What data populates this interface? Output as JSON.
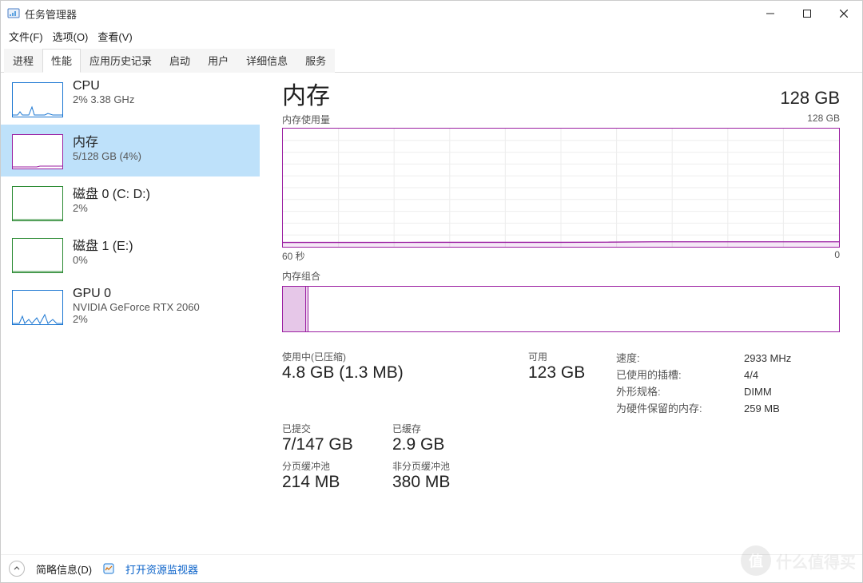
{
  "window": {
    "title": "任务管理器"
  },
  "menu": {
    "file": "文件(F)",
    "options": "选项(O)",
    "view": "查看(V)"
  },
  "tabs": {
    "processes": "进程",
    "performance": "性能",
    "app_history": "应用历史记录",
    "startup": "启动",
    "users": "用户",
    "details": "详细信息",
    "services": "服务"
  },
  "sidebar": [
    {
      "key": "cpu",
      "title": "CPU",
      "sub": "2%  3.38 GHz"
    },
    {
      "key": "mem",
      "title": "内存",
      "sub": "5/128 GB (4%)"
    },
    {
      "key": "disk0",
      "title": "磁盘 0 (C: D:)",
      "sub": "2%"
    },
    {
      "key": "disk1",
      "title": "磁盘 1 (E:)",
      "sub": "0%"
    },
    {
      "key": "gpu0",
      "title": "GPU 0",
      "sub": "NVIDIA GeForce RTX 2060",
      "sub2": "2%"
    }
  ],
  "detail": {
    "title": "内存",
    "capacity": "128 GB",
    "usage_label": "内存使用量",
    "usage_max": "128 GB",
    "axis_left": "60 秒",
    "axis_right": "0",
    "composition_label": "内存组合",
    "stats": {
      "in_use_label": "使用中(已压缩)",
      "in_use_value": "4.8 GB (1.3 MB)",
      "available_label": "可用",
      "available_value": "123 GB",
      "committed_label": "已提交",
      "committed_value": "7/147 GB",
      "cached_label": "已缓存",
      "cached_value": "2.9 GB",
      "paged_label": "分页缓冲池",
      "paged_value": "214 MB",
      "nonpaged_label": "非分页缓冲池",
      "nonpaged_value": "380 MB"
    },
    "info": {
      "speed_label": "速度:",
      "speed_value": "2933 MHz",
      "slots_label": "已使用的插槽:",
      "slots_value": "4/4",
      "form_label": "外形规格:",
      "form_value": "DIMM",
      "reserved_label": "为硬件保留的内存:",
      "reserved_value": "259 MB"
    }
  },
  "footer": {
    "fewer": "简略信息(D)",
    "open_resmon": "打开资源监视器"
  },
  "watermark": "什么值得买",
  "chart_data": {
    "type": "line",
    "title": "内存使用量",
    "xlabel": "60 秒 → 0",
    "ylabel": "GB",
    "ylim": [
      0,
      128
    ],
    "x": [
      60,
      55,
      50,
      45,
      40,
      35,
      30,
      25,
      20,
      15,
      10,
      5,
      0
    ],
    "values": [
      4.7,
      4.7,
      4.7,
      4.8,
      4.8,
      4.8,
      4.8,
      5.0,
      5.4,
      5.4,
      5.4,
      5.4,
      5.4
    ],
    "series_name": "内存使用量 (GB)"
  }
}
